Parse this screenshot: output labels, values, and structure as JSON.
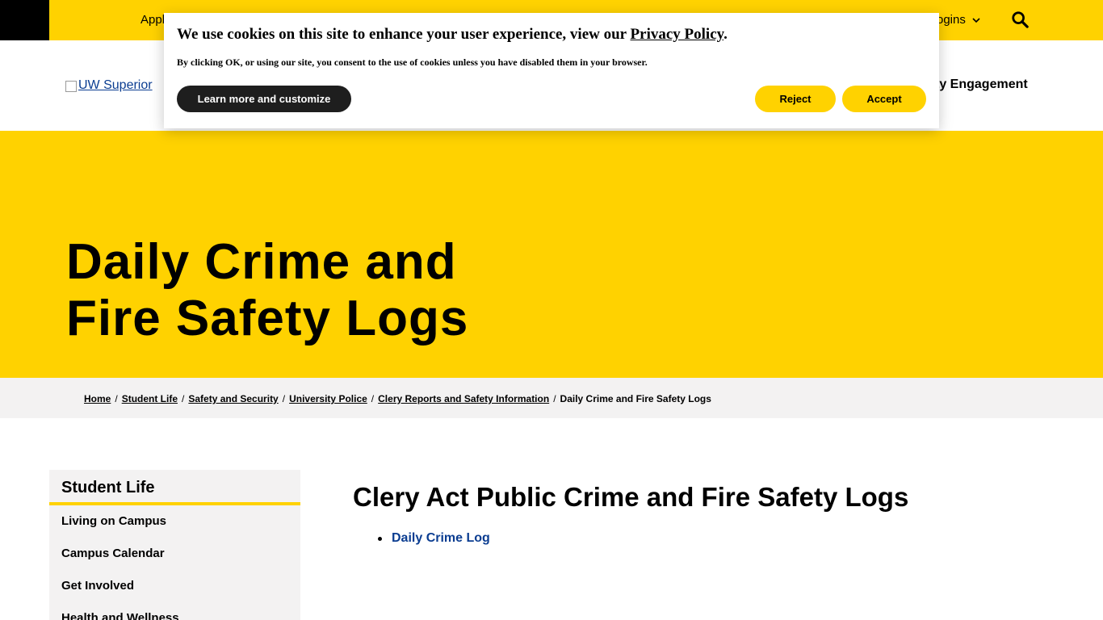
{
  "topbar": {
    "apply_label": "Appl",
    "logins_label": "ogins",
    "search_icon": "search-icon"
  },
  "header": {
    "logo_alt": "UW Superior",
    "engagement_label": "ty Engagement"
  },
  "hero": {
    "title_line1": "Daily Crime and",
    "title_line2": "Fire Safety Logs"
  },
  "breadcrumb": {
    "items": [
      "Home",
      "Student Life",
      "Safety and Security",
      "University Police",
      "Clery Reports and Safety Information"
    ],
    "separator": "/",
    "current": "Daily Crime and Fire Safety Logs"
  },
  "sidebar": {
    "heading": "Student Life",
    "items": [
      "Living on Campus",
      "Campus Calendar",
      "Get Involved",
      "Health and Wellness"
    ]
  },
  "main": {
    "title": "Clery Act Public Crime and Fire Safety Logs",
    "links": [
      "Daily Crime Log"
    ]
  },
  "cookie": {
    "message_prefix": "We use cookies on this site to enhance your user experience, view our ",
    "privacy_link": "Privacy Policy",
    "message_suffix": ".",
    "consent": "By clicking OK, or using our site, you consent to the use of cookies unless you have disabled them in your browser.",
    "learn_label": "Learn more and customize",
    "reject_label": "Reject",
    "accept_label": "Accept"
  },
  "colors": {
    "brand_yellow": "#ffd200",
    "link_blue": "#0b3d91",
    "breadcrumb_bg": "#f3f2f2"
  }
}
